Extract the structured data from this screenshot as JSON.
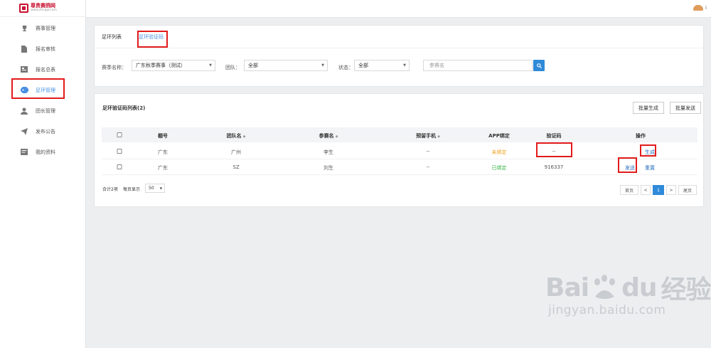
{
  "logo": {
    "name": "尊贵赛鸽网",
    "url": "www.zhcgw.com"
  },
  "user": {
    "name": "i"
  },
  "sidebar": {
    "items": [
      {
        "label": "赛事管理",
        "icon": "trophy-icon"
      },
      {
        "label": "报名审核",
        "icon": "document-icon"
      },
      {
        "label": "报名总表",
        "icon": "list-icon"
      },
      {
        "label": "足环管理",
        "icon": "tag-icon",
        "active": true
      },
      {
        "label": "团长管理",
        "icon": "user-icon"
      },
      {
        "label": "发布公告",
        "icon": "paper-plane-icon"
      },
      {
        "label": "我的资料",
        "icon": "profile-card-icon"
      }
    ]
  },
  "tabs": [
    {
      "label": "足环列表"
    },
    {
      "label": "足环验证码",
      "active": true
    }
  ],
  "filters": {
    "event_label": "赛季名称：",
    "event_value": "广东秋季赛事（测试）",
    "team_label": "团队：",
    "team_value": "全部",
    "status_label": "状态：",
    "status_value": "全部",
    "search_placeholder": "参赛名"
  },
  "list": {
    "title": "足环验证码列表(2)",
    "batch_generate": "批量生成",
    "batch_send": "批量发送",
    "columns": [
      "棚号",
      "团队名",
      "参赛名",
      "预留手机",
      "APP绑定",
      "验证码",
      "操作"
    ],
    "rows": [
      {
        "shed": "广东",
        "team": "广州",
        "entrant": "李生",
        "phone": "--",
        "app": "未绑定",
        "code": "--",
        "actions": [
          "生成"
        ]
      },
      {
        "shed": "广东",
        "team": "SZ",
        "entrant": "刘生",
        "phone": "--",
        "app": "已绑定",
        "code": "916337",
        "actions": [
          "发送",
          "重置"
        ]
      }
    ]
  },
  "pagination": {
    "total_text": "合计2项",
    "per_page_label": "每页显示",
    "per_page_value": "50",
    "first": "首页",
    "prev": "<",
    "current": "1",
    "next": ">",
    "last": "尾页"
  },
  "watermark": {
    "brand_a": "Bai",
    "brand_b": "du",
    "brand_c": "经验",
    "sub": "jingyan.baidu.com"
  },
  "colors": {
    "accent": "#2f8ad9",
    "highlight": "#e21b1b",
    "unbound": "#f0a020",
    "bound": "#3ab54a"
  }
}
